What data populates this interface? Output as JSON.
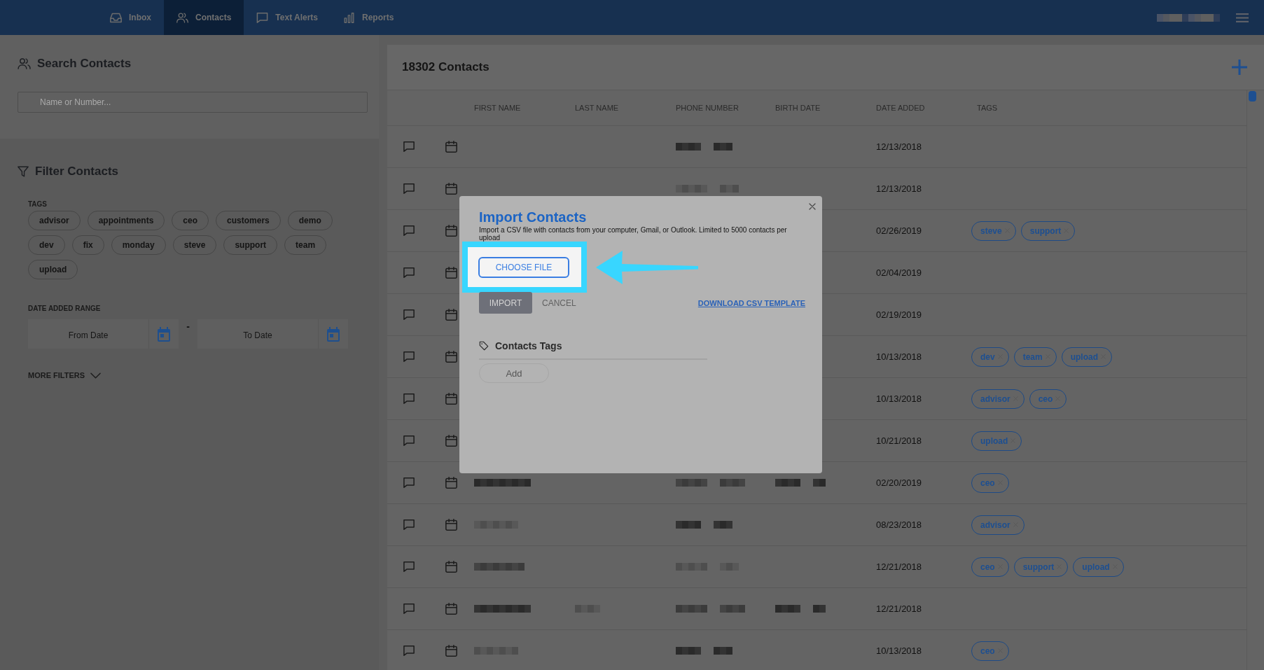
{
  "nav": {
    "tabs": [
      {
        "label": "Inbox",
        "selected": false
      },
      {
        "label": "Contacts",
        "selected": true
      },
      {
        "label": "Text Alerts",
        "selected": false
      },
      {
        "label": "Reports",
        "selected": false
      }
    ],
    "account": {
      "pixelated": true
    }
  },
  "search": {
    "title": "Search Contacts",
    "placeholder": "Name or Number..."
  },
  "filter": {
    "title": "Filter Contacts",
    "tags_label": "TAGS",
    "tags": [
      {
        "label": "advisor",
        "selected": false
      },
      {
        "label": "appointments",
        "selected": false
      },
      {
        "label": "ceo",
        "selected": false
      },
      {
        "label": "customers",
        "selected": false
      },
      {
        "label": "demo",
        "selected": false
      },
      {
        "label": "dev",
        "selected": false
      },
      {
        "label": "fix",
        "selected": false
      },
      {
        "label": "monday",
        "selected": false
      },
      {
        "label": "steve",
        "selected": false
      },
      {
        "label": "support",
        "selected": false
      },
      {
        "label": "team",
        "selected": false
      },
      {
        "label": "upload",
        "selected": false
      }
    ],
    "date_range_label": "DATE ADDED RANGE",
    "from_date": {
      "placeholder": "From Date"
    },
    "separator": "-",
    "to_date": {
      "placeholder": "To Date"
    },
    "more_filters": "MORE FILTERS"
  },
  "contacts": {
    "title": "18302 Contacts",
    "columns": [
      "FIRST NAME",
      "LAST NAME",
      "PHONE NUMBER",
      "BIRTH DATE",
      "DATE ADDED",
      "TAGS"
    ],
    "rows": [
      {
        "first_name_pixelated": false,
        "last_name_pixelated": false,
        "phone_number_pixelated": true,
        "birth_date_pixelated": false,
        "date_added": "12/13/2018"
      },
      {
        "first_name_pixelated": false,
        "last_name_pixelated": false,
        "phone_number_pixelated": true,
        "birth_date_pixelated": false,
        "date_added": "12/13/2018"
      },
      {
        "date_added": "02/26/2019",
        "tags": [
          "steve",
          "support"
        ]
      },
      {
        "date_added": "02/04/2019"
      },
      {
        "date_added": "02/19/2019"
      },
      {
        "date_added": "10/13/2018",
        "tags": [
          "dev",
          "team",
          "upload"
        ]
      },
      {
        "date_added": "10/13/2018",
        "tags": [
          "advisor",
          "ceo"
        ]
      },
      {
        "date_added": "10/21/2018",
        "tags": [
          "upload"
        ]
      },
      {
        "first_name_pixelated": true,
        "last_name_pixelated": false,
        "phone_number_pixelated": true,
        "birth_date_pixelated": true,
        "date_added": "02/20/2019",
        "tags": [
          "ceo"
        ]
      },
      {
        "first_name_pixelated": true,
        "last_name_pixelated": false,
        "phone_number_pixelated": true,
        "birth_date_pixelated": false,
        "date_added": "08/23/2018",
        "tags": [
          "advisor"
        ]
      },
      {
        "first_name_pixelated": true,
        "last_name_pixelated": false,
        "phone_number_pixelated": true,
        "birth_date_pixelated": false,
        "date_added": "12/21/2018",
        "tags": [
          "ceo",
          "support",
          "upload"
        ]
      },
      {
        "first_name_pixelated": true,
        "last_name_pixelated": true,
        "phone_number_pixelated": true,
        "birth_date_pixelated": true,
        "date_added": "12/21/2018"
      },
      {
        "first_name_pixelated": true,
        "last_name_pixelated": false,
        "phone_number_pixelated": true,
        "birth_date_pixelated": false,
        "date_added": "10/13/2018",
        "tags": [
          "ceo"
        ]
      }
    ]
  },
  "import_dialog": {
    "title": "Import Contacts",
    "description": "Import a CSV file with contacts from your computer, Gmail, or Outlook. Limited to 5000 contacts per upload",
    "choose_file": {
      "label": "CHOOSE FILE",
      "highlighted": true
    },
    "import_button": {
      "label": "IMPORT",
      "disabled": true
    },
    "cancel_button": "CANCEL",
    "template_link": "DOWNLOAD CSV TEMPLATE",
    "tags_title": "Contacts Tags",
    "add_button": "Add"
  }
}
